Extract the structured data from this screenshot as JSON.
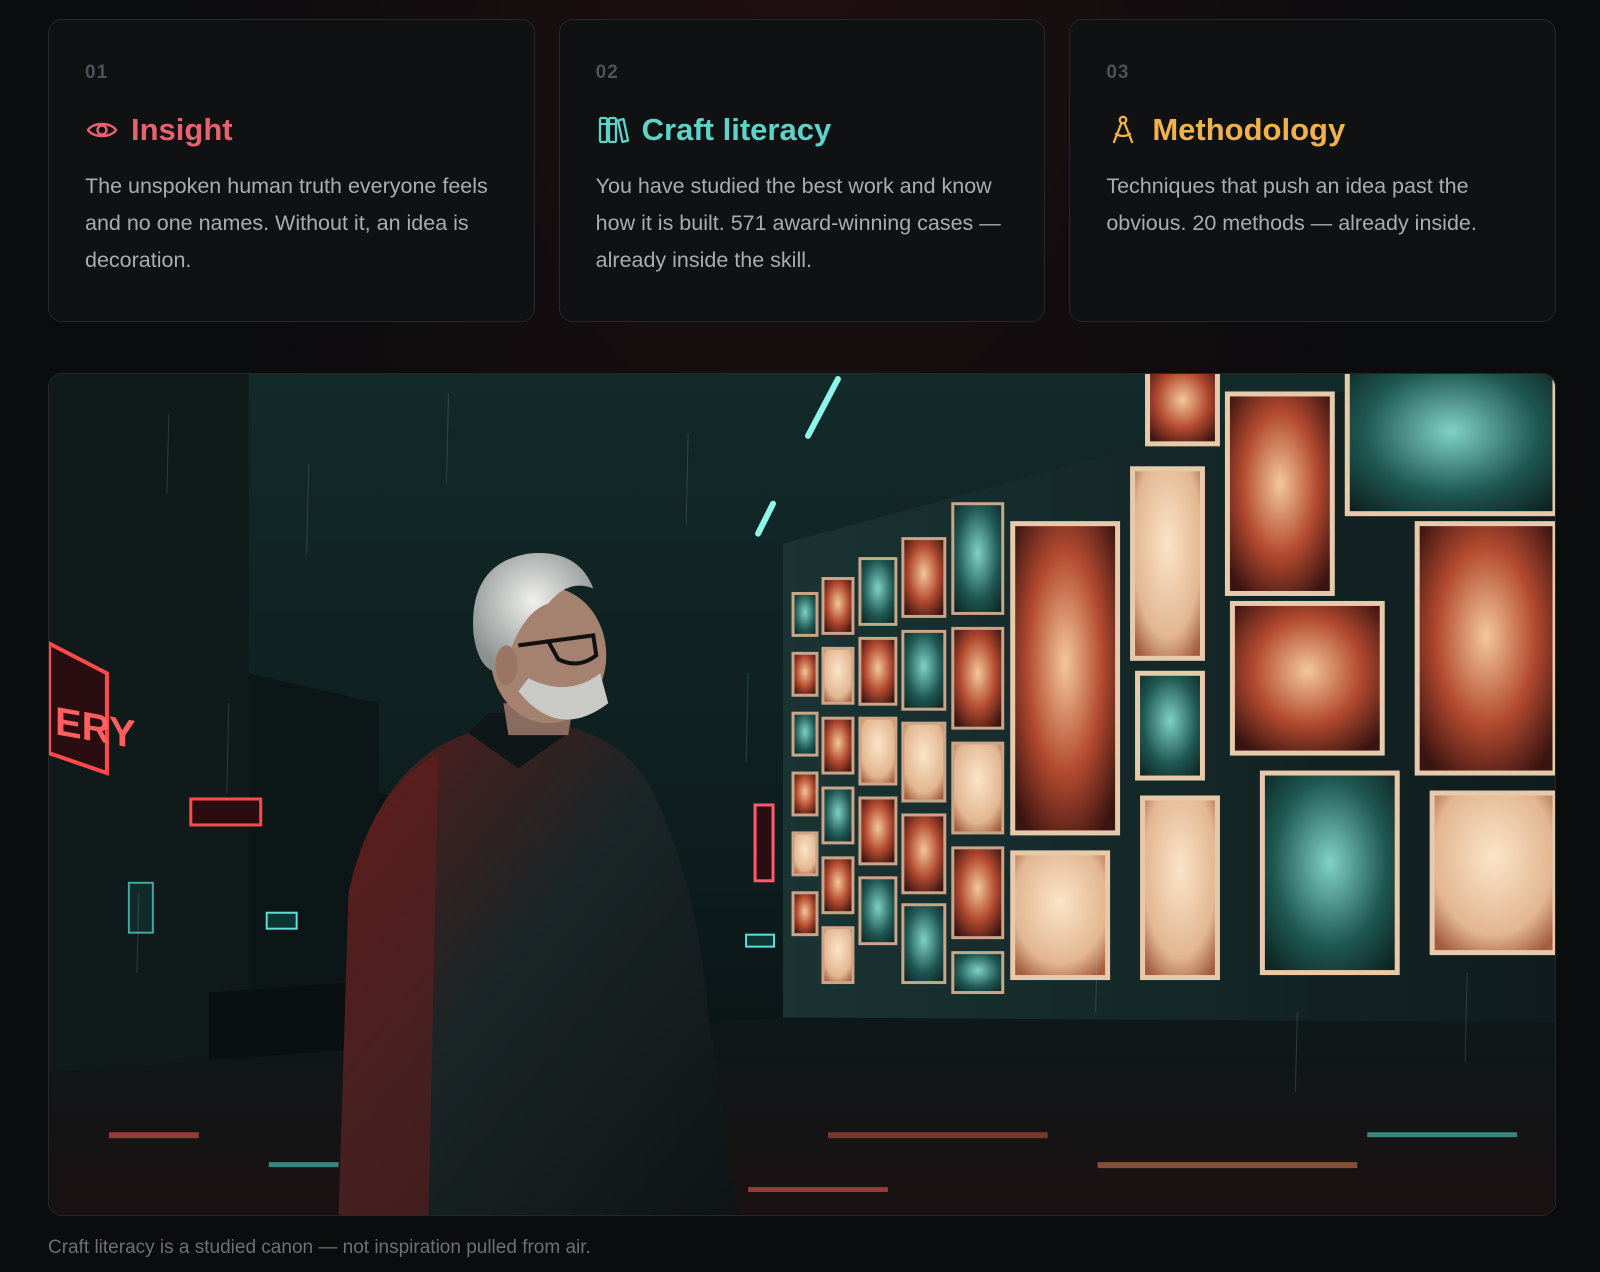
{
  "cards": [
    {
      "number": "01",
      "icon": "eye-icon",
      "title": "Insight",
      "color": "#e8616f",
      "description": "The unspoken human truth everyone feels and no one names. Without it, an idea is decoration."
    },
    {
      "number": "02",
      "icon": "books-icon",
      "title": "Craft literacy",
      "color": "#5fd3c8",
      "description": "You have studied the best work and know how it is built. 571 award-winning cases — already inside the skill."
    },
    {
      "number": "03",
      "icon": "compass-icon",
      "title": "Methodology",
      "color": "#f0b24a",
      "description": "Techniques that push an idea past the obvious. 20 methods — already inside."
    }
  ],
  "hero": {
    "image": "illustration-man-viewing-poster-wall-rainy-alley",
    "neon_sign": "ERY"
  },
  "caption": "Craft literacy is a studied canon — not inspiration pulled from air."
}
